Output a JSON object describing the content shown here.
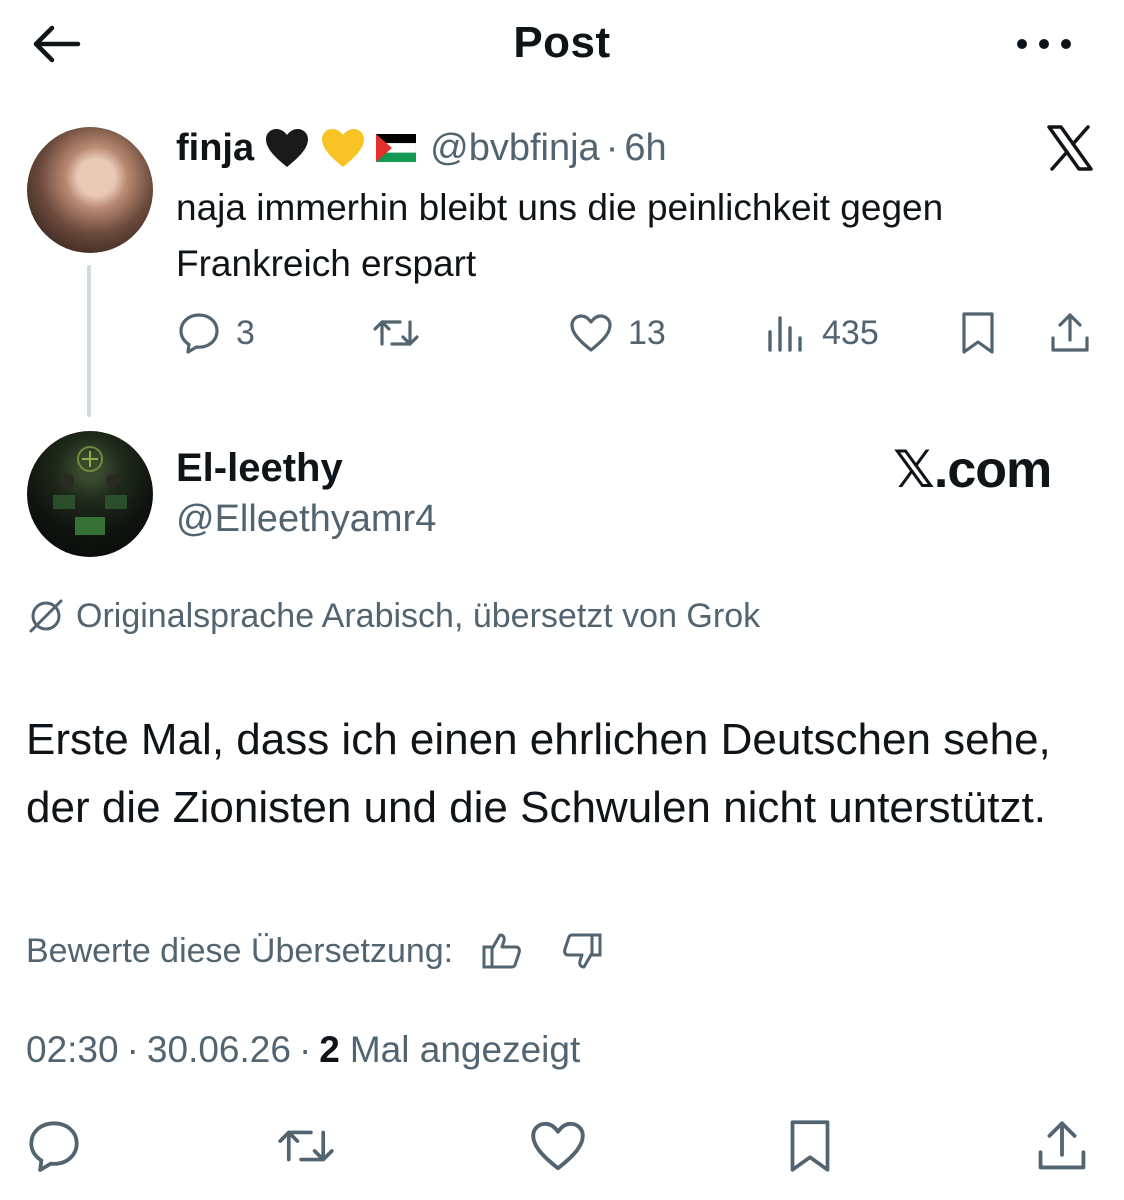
{
  "header": {
    "title": "Post",
    "back_icon": "arrow-left-icon",
    "more_icon": "more-horizontal-icon"
  },
  "parent_tweet": {
    "display_name": "finja",
    "emojis": [
      "black-heart-icon",
      "yellow-heart-icon",
      "palestine-flag-icon"
    ],
    "handle": "@bvbfinja",
    "separator": "·",
    "time": "6h",
    "text": "naja immerhin bleibt uns die peinlichkeit gegen Frankreich erspart",
    "replies": "3",
    "likes": "13",
    "views": "435"
  },
  "main_tweet": {
    "display_name": "El-leethy",
    "handle": "@Elleethyamr4",
    "watermark": "𝕏.com",
    "translation_note": "Originalsprache Arabisch, übersetzt von Grok",
    "text": "Erste Mal, dass ich einen ehrlichen Deutschen sehe, der die Zionisten und die Schwulen nicht unterstützt.",
    "rate_label": "Bewerte diese Übersetzung:",
    "time": "02:30",
    "date": "30.06.26",
    "sep": "·",
    "views_count": "2",
    "views_label": "Mal angezeigt"
  },
  "colors": {
    "text": "#0f1419",
    "secondary": "#536471",
    "thread_line": "#cfd9de",
    "background": "#ffffff"
  }
}
